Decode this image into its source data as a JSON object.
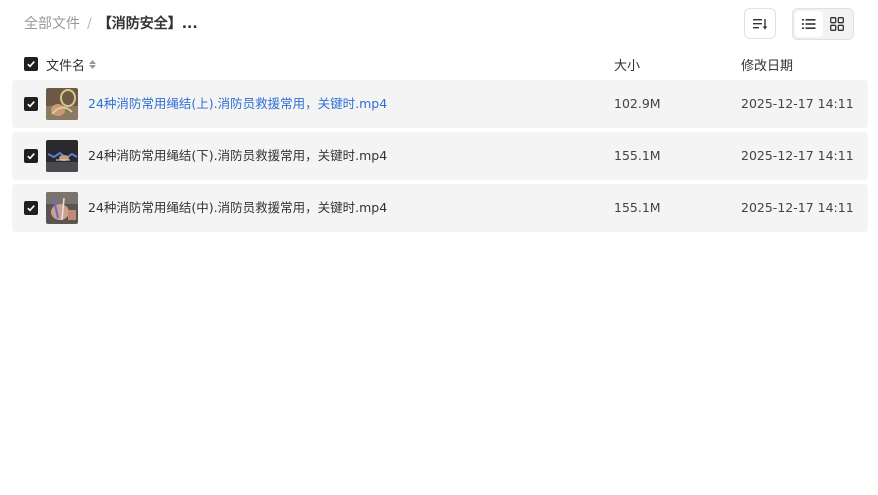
{
  "breadcrumb": {
    "root": "全部文件",
    "separator": "/",
    "current": "【消防安全】..."
  },
  "toolbar": {
    "sort_icon": "sort-list-icon",
    "views": [
      {
        "name": "list-view",
        "icon": "list-icon",
        "active": true
      },
      {
        "name": "grid-view",
        "icon": "grid-icon",
        "active": false
      }
    ]
  },
  "columns": {
    "name": "文件名",
    "size": "大小",
    "modified": "修改日期"
  },
  "files": [
    {
      "name": "24种消防常用绳结(上).消防员救援常用，关键时.mp4",
      "size": "102.9M",
      "modified": "2025-12-17 14:11",
      "checked": true,
      "highlighted": true
    },
    {
      "name": "24种消防常用绳结(下).消防员救援常用，关键时.mp4",
      "size": "155.1M",
      "modified": "2025-12-17 14:11",
      "checked": true,
      "highlighted": false
    },
    {
      "name": "24种消防常用绳结(中).消防员救援常用，关键时.mp4",
      "size": "155.1M",
      "modified": "2025-12-17 14:11",
      "checked": true,
      "highlighted": false
    }
  ],
  "colors": {
    "link": "#2f6fd6",
    "row_bg": "#f4f4f4",
    "checkbox": "#1f1f1f"
  }
}
